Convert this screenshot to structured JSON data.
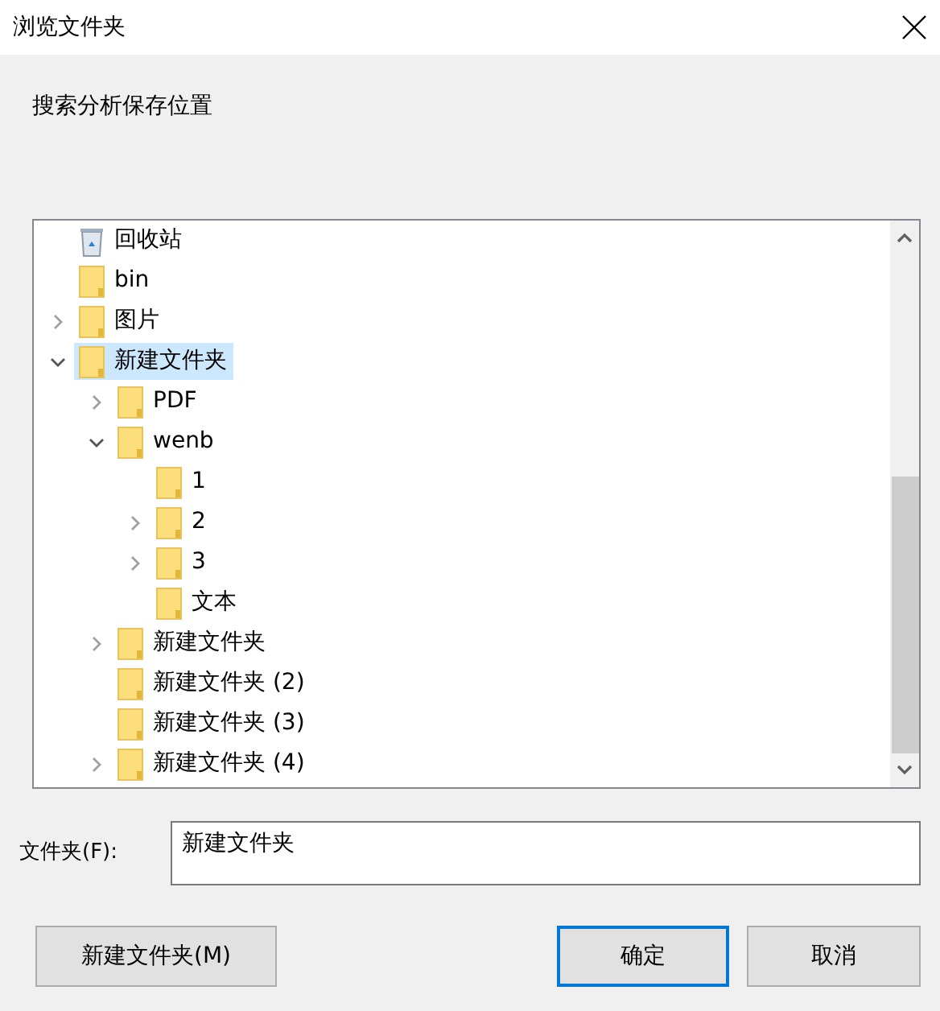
{
  "window": {
    "title": "浏览文件夹"
  },
  "instruction": "搜索分析保存位置",
  "tree": [
    {
      "label": "回收站",
      "kind": "recycle",
      "selected": false
    },
    {
      "label": "bin",
      "kind": "folder",
      "selected": false
    },
    {
      "label": "图片",
      "kind": "folder",
      "selected": false,
      "expanded": false
    },
    {
      "label": "新建文件夹",
      "kind": "folder",
      "selected": true,
      "expanded": true,
      "children": [
        {
          "label": "PDF",
          "kind": "folder",
          "selected": false,
          "expanded": false
        },
        {
          "label": "wenb",
          "kind": "folder",
          "selected": false,
          "expanded": true,
          "children": [
            {
              "label": "1",
              "kind": "folder",
              "selected": false
            },
            {
              "label": "2",
              "kind": "folder",
              "selected": false,
              "expanded": false
            },
            {
              "label": "3",
              "kind": "folder",
              "selected": false,
              "expanded": false
            },
            {
              "label": "文本",
              "kind": "folder",
              "selected": false
            }
          ]
        },
        {
          "label": "新建文件夹",
          "kind": "folder",
          "selected": false,
          "expanded": false
        },
        {
          "label": "新建文件夹 (2)",
          "kind": "folder",
          "selected": false
        },
        {
          "label": "新建文件夹 (3)",
          "kind": "folder",
          "selected": false
        },
        {
          "label": "新建文件夹 (4)",
          "kind": "folder",
          "selected": false,
          "expanded": false
        }
      ]
    }
  ],
  "folder_field": {
    "label": "文件夹(F):",
    "value": "新建文件夹"
  },
  "buttons": [
    {
      "label": "新建文件夹(M)",
      "default": false
    },
    {
      "label": "确定",
      "default": true
    },
    {
      "label": "取消",
      "default": false
    }
  ]
}
